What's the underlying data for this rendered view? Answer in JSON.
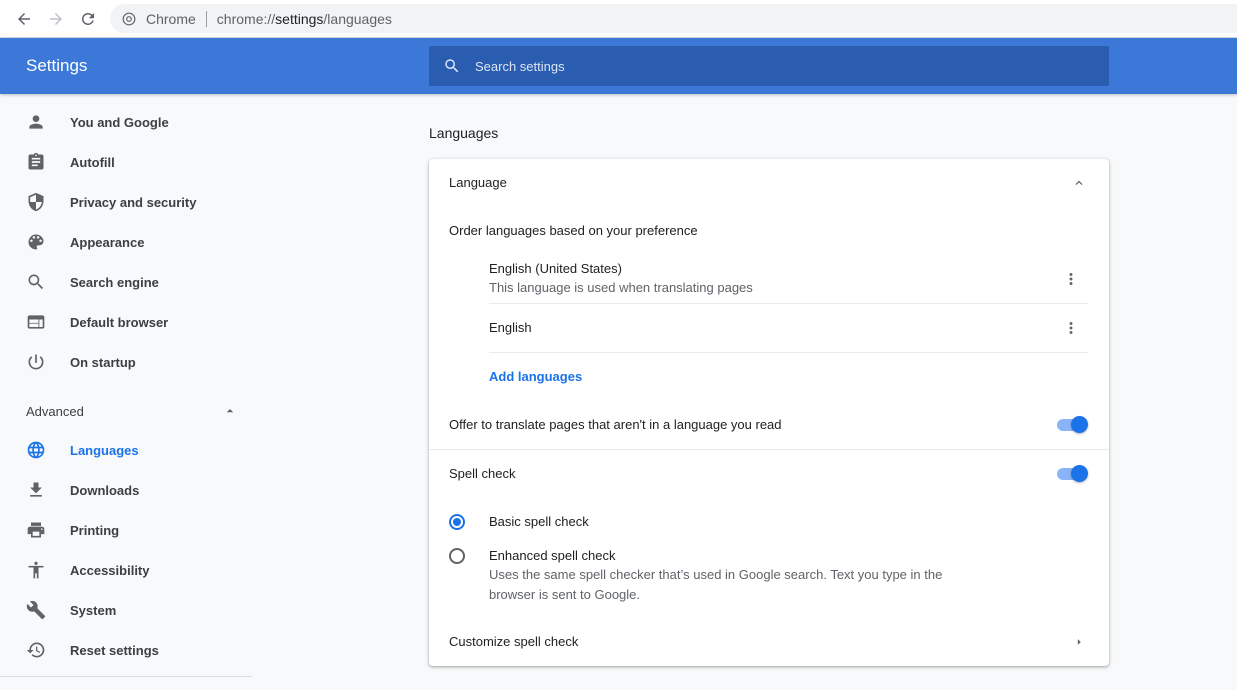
{
  "browser": {
    "site_name": "Chrome",
    "url_prefix": "chrome://",
    "url_host": "settings",
    "url_path": "/languages"
  },
  "header": {
    "title": "Settings",
    "search_placeholder": "Search settings"
  },
  "sidebar": {
    "items": [
      {
        "label": "You and Google",
        "icon": "person-icon"
      },
      {
        "label": "Autofill",
        "icon": "clipboard-icon"
      },
      {
        "label": "Privacy and security",
        "icon": "shield-icon"
      },
      {
        "label": "Appearance",
        "icon": "palette-icon"
      },
      {
        "label": "Search engine",
        "icon": "search-icon"
      },
      {
        "label": "Default browser",
        "icon": "browser-window-icon"
      },
      {
        "label": "On startup",
        "icon": "power-icon"
      }
    ],
    "advanced_label": "Advanced",
    "advanced_items": [
      {
        "label": "Languages",
        "icon": "globe-icon",
        "active": true
      },
      {
        "label": "Downloads",
        "icon": "download-icon"
      },
      {
        "label": "Printing",
        "icon": "printer-icon"
      },
      {
        "label": "Accessibility",
        "icon": "accessibility-icon"
      },
      {
        "label": "System",
        "icon": "wrench-icon"
      },
      {
        "label": "Reset settings",
        "icon": "history-icon"
      }
    ]
  },
  "main": {
    "section_title": "Languages",
    "language_header": "Language",
    "order_label": "Order languages based on your preference",
    "languages": [
      {
        "name": "English (United States)",
        "note": "This language is used when translating pages"
      },
      {
        "name": "English",
        "note": ""
      }
    ],
    "add_languages": "Add languages",
    "offer_translate_label": "Offer to translate pages that aren't in a language you read",
    "offer_translate_on": true,
    "spell_check_label": "Spell check",
    "spell_check_on": true,
    "basic_spell_label": "Basic spell check",
    "basic_spell_selected": true,
    "enhanced_spell_label": "Enhanced spell check",
    "enhanced_spell_desc_1": "Uses the same spell checker that’s used in Google search. Text you type in the",
    "enhanced_spell_desc_2": "browser is sent to Google.",
    "customize_spell_label": "Customize spell check"
  },
  "colors": {
    "header_blue": "#3c78d8",
    "accent": "#1a73e8"
  }
}
